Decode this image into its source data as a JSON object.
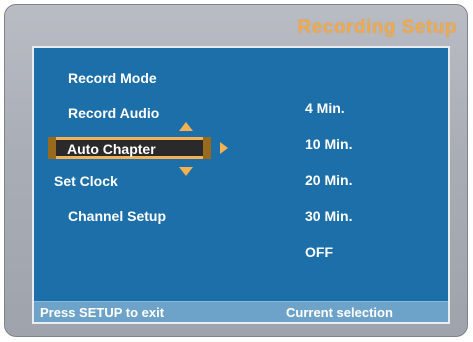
{
  "header": {
    "title": "Recording Setup"
  },
  "menu": {
    "items": [
      {
        "label": "Record Mode"
      },
      {
        "label": "Record Audio"
      },
      {
        "label": "Auto Chapter"
      },
      {
        "label": "Set Clock"
      },
      {
        "label": "Channel Setup"
      }
    ],
    "selected_index": 2
  },
  "options": [
    {
      "label": "4 Min."
    },
    {
      "label": "10 Min."
    },
    {
      "label": "20 Min."
    },
    {
      "label": "30 Min."
    },
    {
      "label": "OFF"
    }
  ],
  "status_bar": {
    "hint": "Press SETUP to exit",
    "current": "Current selection"
  },
  "colors": {
    "accent": "#f3b152",
    "panel": "#1c6fa8",
    "frame": "#a9adb5",
    "status_bar": "#6ea3c9"
  },
  "icons": [
    "up-arrow-icon",
    "down-arrow-icon",
    "right-arrow-icon"
  ]
}
